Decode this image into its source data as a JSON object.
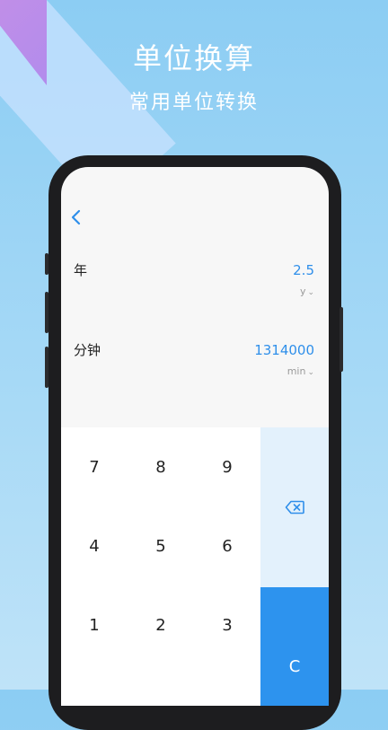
{
  "hero": {
    "title": "单位换算",
    "subtitle": "常用单位转换"
  },
  "converter": {
    "back_icon": "chevron-left-icon",
    "rows": [
      {
        "label": "年",
        "value": "2.5",
        "unit": "y"
      },
      {
        "label": "分钟",
        "value": "1314000",
        "unit": "min"
      }
    ]
  },
  "keypad": {
    "keys": [
      "7",
      "8",
      "9",
      "4",
      "5",
      "6",
      "1",
      "2",
      "3"
    ],
    "delete_icon": "backspace-icon",
    "clear_label": "C"
  },
  "colors": {
    "accent": "#2d93ee",
    "accent_light": "#e3f1fc",
    "background": "#8ccdf3"
  }
}
